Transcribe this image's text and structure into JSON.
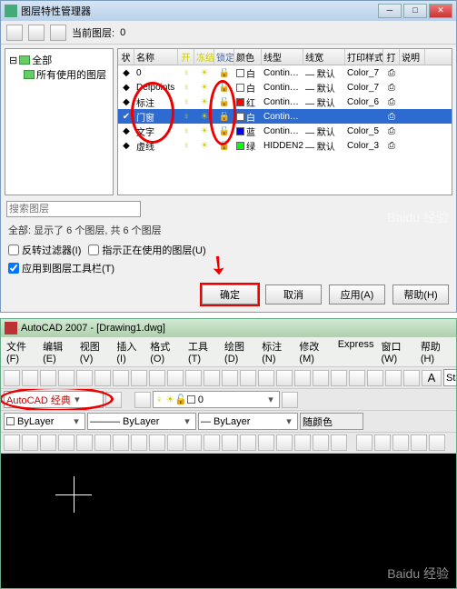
{
  "dialog": {
    "title": "图层特性管理器",
    "current_layer_label": "当前图层:",
    "current_layer_value": "0",
    "tree": {
      "root": "全部",
      "child": "所有使用的图层"
    },
    "headers": [
      "状",
      "名称",
      "开",
      "冻结",
      "锁定",
      "颜色",
      "线型",
      "线宽",
      "打印样式",
      "打",
      "说明"
    ],
    "rows": [
      {
        "name": "0",
        "color_label": "白",
        "swatch": "#ffffff",
        "ltype": "Contin…",
        "lweight": "— 默认",
        "pstyle": "Color_7"
      },
      {
        "name": "Defpoints",
        "color_label": "白",
        "swatch": "#ffffff",
        "ltype": "Contin…",
        "lweight": "— 默认",
        "pstyle": "Color_7"
      },
      {
        "name": "标注",
        "color_label": "红",
        "swatch": "#ff0000",
        "ltype": "Contin…",
        "lweight": "— 默认",
        "pstyle": "Color_6"
      },
      {
        "name": "门窗",
        "color_label": "白",
        "swatch": "#ffffff",
        "ltype": "Contin…",
        "lweight": "",
        "pstyle": ""
      },
      {
        "name": "文字",
        "color_label": "蓝",
        "swatch": "#0000ff",
        "ltype": "Contin…",
        "lweight": "— 默认",
        "pstyle": "Color_5"
      },
      {
        "name": "虚线",
        "color_label": "绿",
        "swatch": "#00ff00",
        "ltype": "HIDDEN2",
        "lweight": "— 默认",
        "pstyle": "Color_3"
      }
    ],
    "search_label": "搜索图层",
    "status_text": "全部: 显示了 6 个图层, 共 6 个图层",
    "invert_filter": "反转过滤器(I)",
    "indicate_in_use": "指示正在使用的图层(U)",
    "apply_to_toolbar": "应用到图层工具栏(T)",
    "buttons": {
      "ok": "确定",
      "cancel": "取消",
      "apply": "应用(A)",
      "help": "帮助(H)"
    }
  },
  "watermark": "Baidu 经验",
  "acad": {
    "title": "AutoCAD 2007 - [Drawing1.dwg]",
    "menus": [
      "文件(F)",
      "编辑(E)",
      "视图(V)",
      "插入(I)",
      "格式(O)",
      "工具(T)",
      "绘图(D)",
      "标注(N)",
      "修改(M)",
      "Express",
      "窗口(W)",
      "帮助(H)"
    ],
    "workspace": "AutoCAD 经典",
    "style_label": "Standar",
    "layer_combo": "0",
    "bylayer": "ByLayer",
    "color_combo": "随颜色"
  }
}
